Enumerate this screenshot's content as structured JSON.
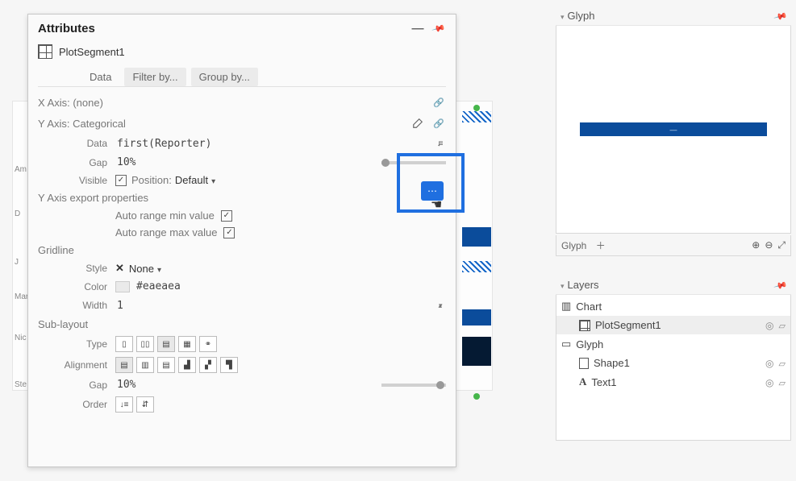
{
  "panel_title": "Attributes",
  "object_name": "PlotSegment1",
  "tabs": {
    "data": "Data",
    "filter": "Filter by...",
    "group": "Group by..."
  },
  "xaxis": {
    "label": "X Axis: (none)"
  },
  "yaxis": {
    "label": "Y Axis: Categorical",
    "data_label": "Data",
    "data_value": "first(Reporter)",
    "gap_label": "Gap",
    "gap_value": "10%",
    "visible_label": "Visible",
    "position_label": "Position:",
    "position_value": "Default"
  },
  "export": {
    "section": "Y Axis export properties",
    "min_label": "Auto range min value",
    "max_label": "Auto range max value"
  },
  "gridline": {
    "section": "Gridline",
    "style_label": "Style",
    "style_value": "None",
    "color_label": "Color",
    "color_value": "#eaeaea",
    "width_label": "Width",
    "width_value": "1"
  },
  "sublayout": {
    "section": "Sub-layout",
    "type_label": "Type",
    "align_label": "Alignment",
    "gap_label": "Gap",
    "gap_value": "10%",
    "order_label": "Order"
  },
  "glyph": {
    "header": "Glyph",
    "footer_label": "Glyph"
  },
  "layers": {
    "header": "Layers",
    "items": [
      {
        "name": "Chart"
      },
      {
        "name": "PlotSegment1"
      },
      {
        "name": "Glyph"
      },
      {
        "name": "Shape1"
      },
      {
        "name": "Text1"
      }
    ]
  },
  "canvas_labels": [
    "Am",
    "D",
    "J",
    "Mar",
    "Nic",
    "Ste"
  ]
}
